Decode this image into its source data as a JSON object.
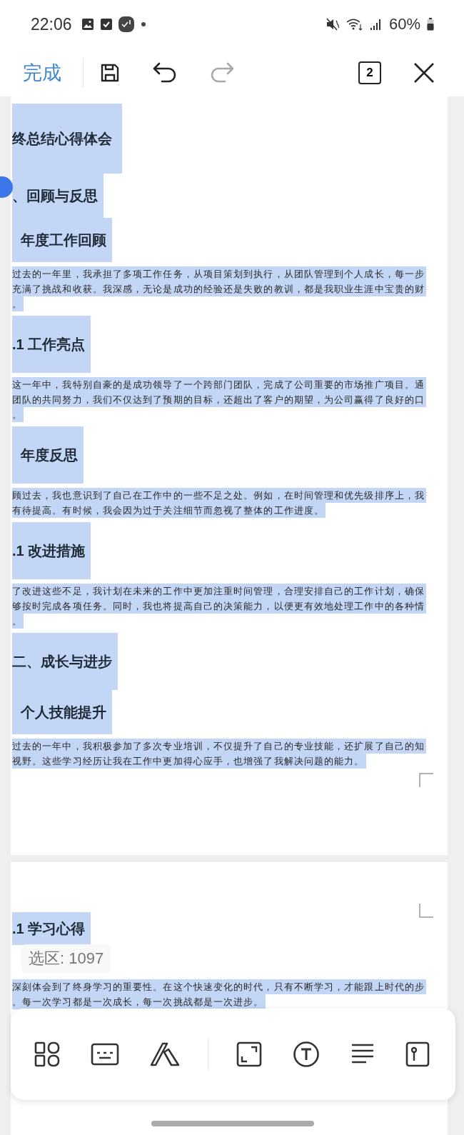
{
  "status_bar": {
    "time": "22:06",
    "battery": "60%"
  },
  "toolbar": {
    "done": "完成",
    "undo": {
      "disabled": false
    },
    "redo": {
      "disabled": true
    },
    "page_count": "2"
  },
  "document": {
    "pages": [
      {
        "blocks": [
          {
            "kind": "title",
            "indented": false,
            "selected": true,
            "text": "终总结心得体会"
          },
          {
            "kind": "heading",
            "indented": false,
            "selected": true,
            "text": "、回顾与反思"
          },
          {
            "kind": "heading",
            "indented": true,
            "selected": true,
            "text": "年度工作回顾"
          },
          {
            "kind": "paragraph",
            "selected": true,
            "lines": [
              "过去的一年里，我承担了多项工作任务，从项目策划到执行，从团队管理到个人成长，每一步",
              "充满了挑战和收获。我深感，无论是成功的经验还是失败的教训，都是我职业生涯中宝贵的财",
              "。"
            ]
          },
          {
            "kind": "subheading",
            "indented": false,
            "selected": true,
            "text": ".1  工作亮点"
          },
          {
            "kind": "paragraph",
            "selected": true,
            "lines": [
              "这一年中，我特别自豪的是成功领导了一个跨部门团队，完成了公司重要的市场推广项目。通",
              "团队的共同努力，我们不仅达到了预期的目标，还超出了客户的期望，为公司赢得了良好的口",
              "。"
            ]
          },
          {
            "kind": "subheading",
            "indented": true,
            "selected": true,
            "text": "年度反思"
          },
          {
            "kind": "paragraph",
            "selected": true,
            "lines": [
              "顾过去，我也意识到了自己在工作中的一些不足之处。例如，在时间管理和优先级排序上，我",
              "有待提高。有时候，我会因为过于关注细节而忽视了整体的工作进度。"
            ]
          },
          {
            "kind": "subheading",
            "indented": false,
            "selected": true,
            "text": ".1  改进措施"
          },
          {
            "kind": "paragraph",
            "selected": true,
            "lines": [
              "了改进这些不足，我计划在未来的工作中更加注重时间管理，合理安排自己的工作计划，确保",
              "够按时完成各项任务。同时，我也将提高自己的决策能力，以便更有效地处理工作中的各种情",
              "。"
            ]
          },
          {
            "kind": "subheading",
            "indented": false,
            "selected": true,
            "text": "二、成长与进步"
          },
          {
            "kind": "heading",
            "indented": true,
            "selected": true,
            "text": "个人技能提升"
          },
          {
            "kind": "paragraph",
            "selected": true,
            "lines": [
              "过去的一年中，我积极参加了多次专业培训，不仅提升了自己的专业技能，还扩展了自己的知",
              "视野。这些学习经历让我在工作中更加得心应手，也增强了我解决问题的能力。"
            ]
          }
        ]
      },
      {
        "blocks": [
          {
            "kind": "heading",
            "indented": false,
            "selected": true,
            "text": ".1  学习心得"
          },
          {
            "kind": "paragraph",
            "selected": true,
            "lines": [
              "深刻体会到了终身学习的重要性。在这个快速变化的时代，只有不断学习，才能跟上时代的步",
              "。每一次学习都是一次成长，每一次挑战都是一次进步。"
            ]
          }
        ]
      }
    ]
  },
  "selection_count": "选区: 1097"
}
